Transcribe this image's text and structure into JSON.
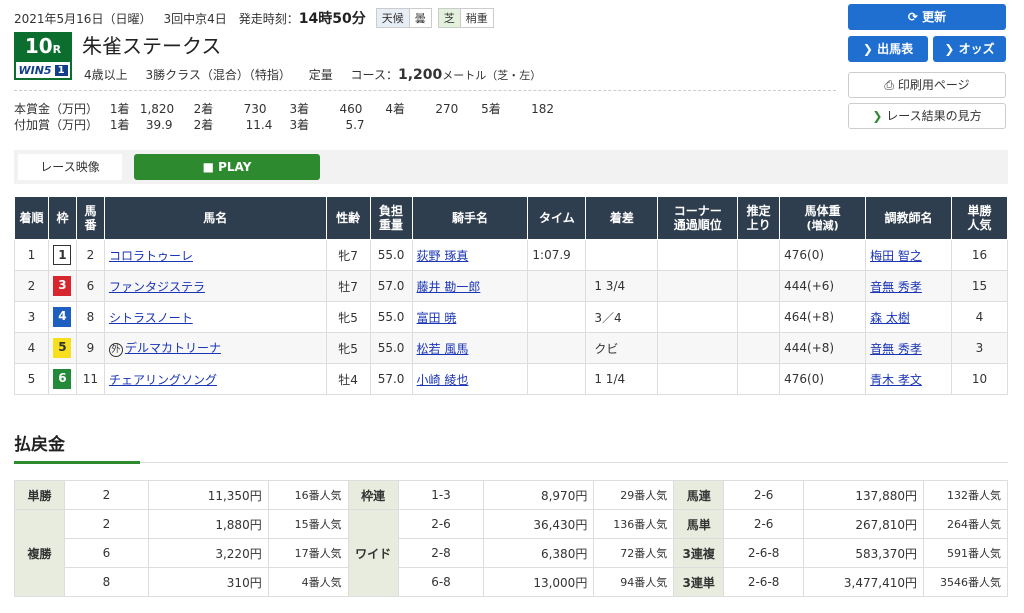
{
  "header": {
    "date": "2021年5月16日（日曜）",
    "meeting": "3回中京4日",
    "post_time_label": "発走時刻：",
    "post_time": "14時50分",
    "weather_label": "天候",
    "weather": "曇",
    "track_label": "芝",
    "track_condition": "稍重"
  },
  "race": {
    "number": "10",
    "number_suffix": "R",
    "win5_label": "WIN5",
    "win5_leg": "1",
    "title": "朱雀ステークス",
    "conditions": [
      "4歳以上",
      "3勝クラス（混合）（特指）",
      "定量"
    ],
    "course_label": "コース：",
    "course_distance": "1,200",
    "course_unit": "メートル（芝・左）"
  },
  "prize": {
    "main_label": "本賞金（万円）",
    "main": [
      {
        "place": "1着",
        "value": "1,820"
      },
      {
        "place": "2着",
        "value": "730"
      },
      {
        "place": "3着",
        "value": "460"
      },
      {
        "place": "4着",
        "value": "270"
      },
      {
        "place": "5着",
        "value": "182"
      }
    ],
    "extra_label": "付加賞（万円）",
    "extra": [
      {
        "place": "1着",
        "value": "39.9"
      },
      {
        "place": "2着",
        "value": "11.4"
      },
      {
        "place": "3着",
        "value": "5.7"
      }
    ]
  },
  "buttons": {
    "refresh": "更新",
    "entries": "出馬表",
    "odds": "オッズ",
    "print": "印刷用ページ",
    "howto": "レース結果の見方"
  },
  "video": {
    "label": "レース映像",
    "play": "PLAY"
  },
  "results": {
    "headers": {
      "finish": "着順",
      "frame": "枠",
      "number": [
        "馬",
        "番"
      ],
      "horse": "馬名",
      "sex_age": "性齢",
      "weight": [
        "負担",
        "重量"
      ],
      "jockey": "騎手名",
      "time": "タイム",
      "margin": "着差",
      "corner": [
        "コーナー",
        "通過順位"
      ],
      "last": [
        "推定",
        "上り"
      ],
      "body": [
        "馬体重",
        "(増減)"
      ],
      "trainer": "調教師名",
      "pop": [
        "単勝",
        "人気"
      ]
    },
    "rows": [
      {
        "finish": "1",
        "frame": "1",
        "number": "2",
        "mark": "",
        "horse": "コロラトゥーレ",
        "sex_age": "牝7",
        "weight": "55.0",
        "jockey": "荻野 琢真",
        "time": "1:07.9",
        "margin": "",
        "body": "476(0)",
        "trainer": "梅田 智之",
        "pop": "16"
      },
      {
        "finish": "2",
        "frame": "3",
        "number": "6",
        "mark": "",
        "horse": "ファンタジステラ",
        "sex_age": "牡7",
        "weight": "57.0",
        "jockey": "藤井 勘一郎",
        "time": "",
        "margin": "1 3/4",
        "body": "444(+6)",
        "trainer": "音無 秀孝",
        "pop": "15"
      },
      {
        "finish": "3",
        "frame": "4",
        "number": "8",
        "mark": "",
        "horse": "シトラスノート",
        "sex_age": "牝5",
        "weight": "55.0",
        "jockey": "富田 暁",
        "time": "",
        "margin": "3／4",
        "body": "464(+8)",
        "trainer": "森 太樹",
        "pop": "4"
      },
      {
        "finish": "4",
        "frame": "5",
        "number": "9",
        "mark": "外",
        "horse": "デルマカトリーナ",
        "sex_age": "牝5",
        "weight": "55.0",
        "jockey": "松若 風馬",
        "time": "",
        "margin": "クビ",
        "body": "444(+8)",
        "trainer": "音無 秀孝",
        "pop": "3"
      },
      {
        "finish": "5",
        "frame": "6",
        "number": "11",
        "mark": "",
        "horse": "チェアリングソング",
        "sex_age": "牡4",
        "weight": "57.0",
        "jockey": "小崎 綾也",
        "time": "",
        "margin": "1 1/4",
        "body": "476(0)",
        "trainer": "青木 孝文",
        "pop": "10"
      }
    ]
  },
  "payout": {
    "title": "払戻金",
    "tansho": {
      "label": "単勝",
      "rows": [
        {
          "combo": "2",
          "amount": "11,350円",
          "pop": "16番人気"
        }
      ]
    },
    "fukusho": {
      "label": "複勝",
      "rows": [
        {
          "combo": "2",
          "amount": "1,880円",
          "pop": "15番人気"
        },
        {
          "combo": "6",
          "amount": "3,220円",
          "pop": "17番人気"
        },
        {
          "combo": "8",
          "amount": "310円",
          "pop": "4番人気"
        }
      ]
    },
    "wakuren": {
      "label": "枠連",
      "rows": [
        {
          "combo": "1-3",
          "amount": "8,970円",
          "pop": "29番人気"
        }
      ]
    },
    "wide": {
      "label": "ワイド",
      "rows": [
        {
          "combo": "2-6",
          "amount": "36,430円",
          "pop": "136番人気"
        },
        {
          "combo": "2-8",
          "amount": "6,380円",
          "pop": "72番人気"
        },
        {
          "combo": "6-8",
          "amount": "13,000円",
          "pop": "94番人気"
        }
      ]
    },
    "umaren": {
      "label": "馬連",
      "rows": [
        {
          "combo": "2-6",
          "amount": "137,880円",
          "pop": "132番人気"
        }
      ]
    },
    "umatan": {
      "label": "馬単",
      "rows": [
        {
          "combo": "2-6",
          "amount": "267,810円",
          "pop": "264番人気"
        }
      ]
    },
    "trio": {
      "label": "3連複",
      "rows": [
        {
          "combo": "2-6-8",
          "amount": "583,370円",
          "pop": "591番人気"
        }
      ]
    },
    "trifecta": {
      "label": "3連単",
      "rows": [
        {
          "combo": "2-6-8",
          "amount": "3,477,410円",
          "pop": "3546番人気"
        }
      ]
    }
  },
  "colors": {
    "accent_green": "#2e8a2e",
    "button_blue": "#1f6fd1",
    "header_dark": "#2f3e4e",
    "link_blue": "#1a35b5"
  }
}
